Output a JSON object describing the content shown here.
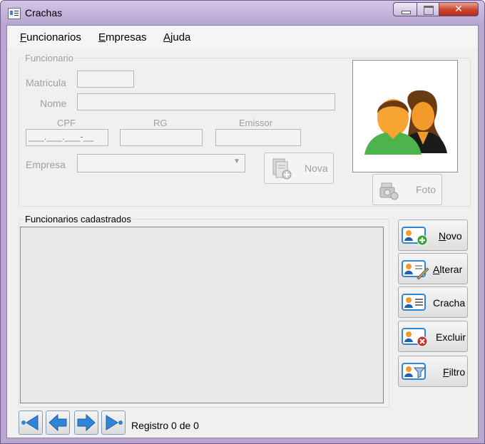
{
  "window": {
    "title": "Crachas",
    "close_glyph": "✕"
  },
  "menu": [
    {
      "label": "Funcionarios"
    },
    {
      "label": "Empresas"
    },
    {
      "label": "Ajuda"
    }
  ],
  "funcionario": {
    "legend": "Funcionario",
    "matricula_label": "Matricula",
    "nome_label": "Nome",
    "cpf_label": "CPF",
    "cpf_mask": "___.___.___-__",
    "rg_label": "RG",
    "emissor_label": "Emissor",
    "empresa_label": "Empresa",
    "nova_label": "Nova",
    "foto_label": "Foto"
  },
  "list": {
    "legend": "Funcionarios cadastrados"
  },
  "actions": [
    {
      "label": "Novo",
      "icon": "card-add-icon",
      "accent": "#2ea52e"
    },
    {
      "label": "Alterar",
      "icon": "card-edit-icon",
      "accent": "#c8a040"
    },
    {
      "label": "Cracha",
      "icon": "card-badge-icon",
      "accent": "#2a5fa8"
    },
    {
      "label": "Excluir",
      "icon": "card-delete-icon",
      "accent": "#d02a2a"
    },
    {
      "label": "Filtro",
      "icon": "card-filter-icon",
      "accent": "#2a5fa8"
    }
  ],
  "navigation": {
    "status": "Registro 0 de 0",
    "buttons": [
      "first-icon",
      "previous-icon",
      "next-icon",
      "last-icon"
    ]
  },
  "colors": {
    "titlebar": "#c8b8e0",
    "client": "#f0f0f0",
    "accent_blue": "#2f86d8"
  }
}
